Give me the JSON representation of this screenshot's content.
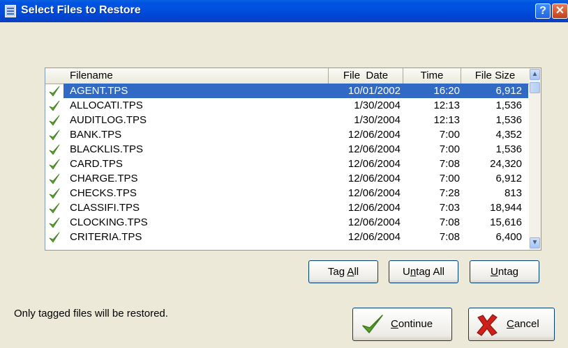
{
  "window": {
    "title": "Select Files to Restore",
    "help_glyph": "?",
    "close_glyph": "✕"
  },
  "columns": {
    "filename": "Filename",
    "file_date": "File  Date",
    "time": "Time",
    "file_size": "File Size"
  },
  "files": [
    {
      "name": "AGENT.TPS",
      "date": "10/01/2002",
      "time": "16:20",
      "size": "6,912",
      "selected": true
    },
    {
      "name": "ALLOCATI.TPS",
      "date": "1/30/2004",
      "time": "12:13",
      "size": "1,536"
    },
    {
      "name": "AUDITLOG.TPS",
      "date": "1/30/2004",
      "time": "12:13",
      "size": "1,536"
    },
    {
      "name": "BANK.TPS",
      "date": "12/06/2004",
      "time": "7:00",
      "size": "4,352"
    },
    {
      "name": "BLACKLIS.TPS",
      "date": "12/06/2004",
      "time": "7:00",
      "size": "1,536"
    },
    {
      "name": "CARD.TPS",
      "date": "12/06/2004",
      "time": "7:08",
      "size": "24,320"
    },
    {
      "name": "CHARGE.TPS",
      "date": "12/06/2004",
      "time": "7:00",
      "size": "6,912"
    },
    {
      "name": "CHECKS.TPS",
      "date": "12/06/2004",
      "time": "7:28",
      "size": "813"
    },
    {
      "name": "CLASSIFI.TPS",
      "date": "12/06/2004",
      "time": "7:03",
      "size": "18,944"
    },
    {
      "name": "CLOCKING.TPS",
      "date": "12/06/2004",
      "time": "7:08",
      "size": "15,616"
    },
    {
      "name": "CRITERIA.TPS",
      "date": "12/06/2004",
      "time": "7:08",
      "size": "6,400"
    }
  ],
  "buttons": {
    "tag_all_pre": "Tag ",
    "tag_all_key": "A",
    "tag_all_post": "ll",
    "untag_all_pre": "U",
    "untag_all_key": "n",
    "untag_all_post": "tag All",
    "untag_key": "U",
    "untag_post": "ntag",
    "continue_key": "C",
    "continue_post": "ontinue",
    "cancel_key": "C",
    "cancel_post": "ancel"
  },
  "status_text": "Only tagged files will be restored.",
  "icons": {
    "check": "checkmark-icon",
    "cancel": "x-icon",
    "scroll_up": "scroll-up-icon",
    "scroll_down": "scroll-down-icon"
  }
}
